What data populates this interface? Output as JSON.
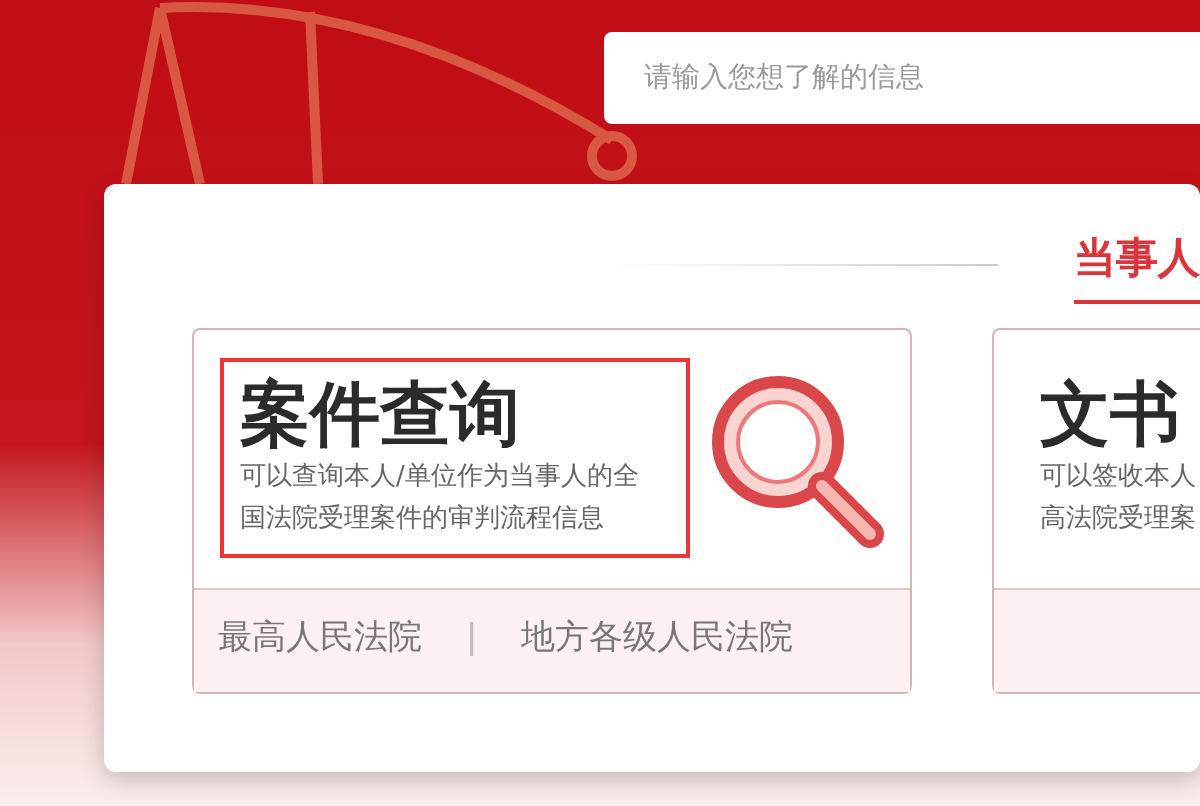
{
  "search": {
    "placeholder": "请输入您想了解的信息"
  },
  "section_tab": {
    "label": "当事人",
    "selected": true
  },
  "cards": [
    {
      "title": "案件查询",
      "lines": [
        "可以查询本人/单位作为当事人的全",
        "国法院受理案件的审判流程信息"
      ],
      "highlighted": true,
      "kind": "search",
      "links": [
        "最高人民法院",
        "地方各级人民法院"
      ],
      "separator": "|"
    },
    {
      "title": "文书",
      "lines": [
        "可以签收本人",
        "高法院受理案"
      ],
      "highlighted": false,
      "kind": "plain"
    }
  ]
}
